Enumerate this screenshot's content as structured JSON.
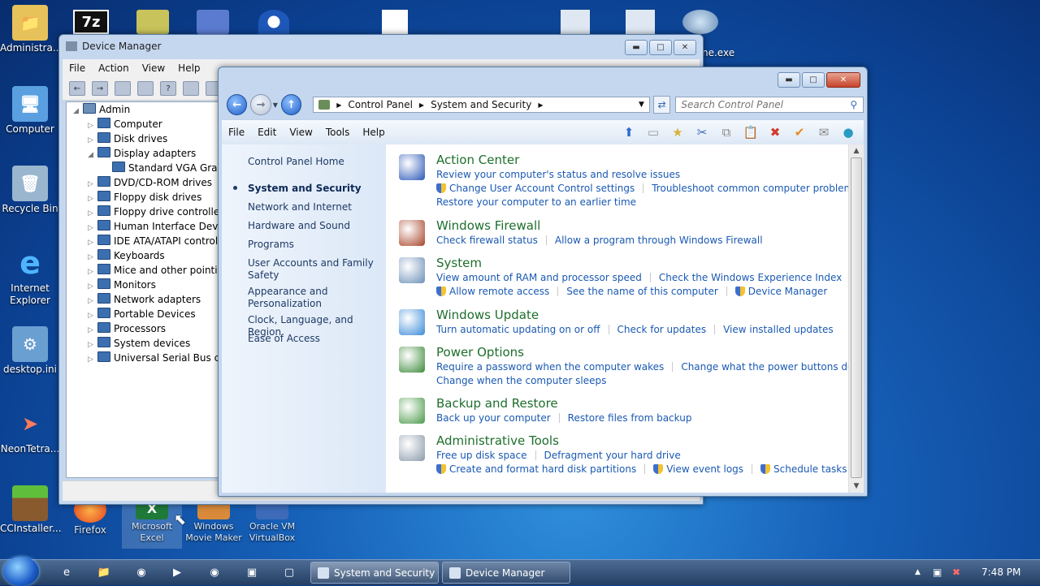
{
  "desktop": {
    "icons": [
      {
        "label": "Administra..."
      },
      {
        "label": "Computer"
      },
      {
        "label": "Recycle Bin"
      },
      {
        "label": "Internet Explorer"
      },
      {
        "label": "desktop.ini"
      },
      {
        "label": "NeonTetra..."
      },
      {
        "label": "CCInstaller..."
      },
      {
        "label": "Firefox"
      },
      {
        "label": "Microsoft Excel"
      },
      {
        "label": "Windows Movie Maker"
      },
      {
        "label": "Oracle VM VirtualBox"
      },
      {
        "label": "ne.exe"
      }
    ],
    "top_icon_glyph": "7z"
  },
  "device_manager": {
    "title": "Device Manager",
    "menu": [
      "File",
      "Action",
      "View",
      "Help"
    ],
    "tree": {
      "root": "Admin",
      "items": [
        {
          "label": "Computer",
          "expanded": false
        },
        {
          "label": "Disk drives",
          "expanded": false
        },
        {
          "label": "Display adapters",
          "expanded": true
        },
        {
          "label": "Standard VGA Graphics Adapter",
          "child": true
        },
        {
          "label": "DVD/CD-ROM drives",
          "expanded": false
        },
        {
          "label": "Floppy disk drives",
          "expanded": false
        },
        {
          "label": "Floppy drive controllers",
          "expanded": false
        },
        {
          "label": "Human Interface Devices",
          "expanded": false
        },
        {
          "label": "IDE ATA/ATAPI controllers",
          "expanded": false
        },
        {
          "label": "Keyboards",
          "expanded": false
        },
        {
          "label": "Mice and other pointing devices",
          "expanded": false
        },
        {
          "label": "Monitors",
          "expanded": false
        },
        {
          "label": "Network adapters",
          "expanded": false
        },
        {
          "label": "Portable Devices",
          "expanded": false
        },
        {
          "label": "Processors",
          "expanded": false
        },
        {
          "label": "System devices",
          "expanded": false
        },
        {
          "label": "Universal Serial Bus controllers",
          "expanded": false
        }
      ]
    }
  },
  "control_panel": {
    "breadcrumb": [
      "Control Panel",
      "System and Security"
    ],
    "search_placeholder": "Search Control Panel",
    "menu": [
      "File",
      "Edit",
      "View",
      "Tools",
      "Help"
    ],
    "left_nav": [
      {
        "label": "Control Panel Home",
        "current": false
      },
      {
        "label": "System and Security",
        "current": true
      },
      {
        "label": "Network and Internet",
        "current": false
      },
      {
        "label": "Hardware and Sound",
        "current": false
      },
      {
        "label": "Programs",
        "current": false
      },
      {
        "label": "User Accounts and Family Safety",
        "current": false
      },
      {
        "label": "Appearance and Personalization",
        "current": false
      },
      {
        "label": "Clock, Language, and Region",
        "current": false
      },
      {
        "label": "Ease of Access",
        "current": false
      }
    ],
    "categories": [
      {
        "title": "Action Center",
        "lines": [
          [
            {
              "text": "Review your computer's status and resolve issues"
            }
          ],
          [
            {
              "text": "Change User Account Control settings",
              "shield": true
            },
            {
              "text": "Troubleshoot common computer problems"
            }
          ],
          [
            {
              "text": "Restore your computer to an earlier time"
            }
          ]
        ]
      },
      {
        "title": "Windows Firewall",
        "lines": [
          [
            {
              "text": "Check firewall status"
            },
            {
              "text": "Allow a program through Windows Firewall"
            }
          ]
        ]
      },
      {
        "title": "System",
        "lines": [
          [
            {
              "text": "View amount of RAM and processor speed"
            },
            {
              "text": "Check the Windows Experience Index"
            }
          ],
          [
            {
              "text": "Allow remote access",
              "shield": true
            },
            {
              "text": "See the name of this computer"
            },
            {
              "text": "Device Manager",
              "shield": true
            }
          ]
        ]
      },
      {
        "title": "Windows Update",
        "lines": [
          [
            {
              "text": "Turn automatic updating on or off"
            },
            {
              "text": "Check for updates"
            },
            {
              "text": "View installed updates"
            }
          ]
        ]
      },
      {
        "title": "Power Options",
        "lines": [
          [
            {
              "text": "Require a password when the computer wakes"
            },
            {
              "text": "Change what the power buttons do"
            }
          ],
          [
            {
              "text": "Change when the computer sleeps"
            }
          ]
        ]
      },
      {
        "title": "Backup and Restore",
        "lines": [
          [
            {
              "text": "Back up your computer"
            },
            {
              "text": "Restore files from backup"
            }
          ]
        ]
      },
      {
        "title": "Administrative Tools",
        "lines": [
          [
            {
              "text": "Free up disk space"
            },
            {
              "text": "Defragment your hard drive"
            }
          ],
          [
            {
              "text": "Create and format hard disk partitions",
              "shield": true
            },
            {
              "text": "View event logs",
              "shield": true
            },
            {
              "text": "Schedule tasks",
              "shield": true
            }
          ]
        ]
      }
    ]
  },
  "taskbar": {
    "buttons": [
      {
        "label": "System and Security"
      },
      {
        "label": "Device Manager"
      }
    ],
    "clock": "7:48 PM"
  },
  "colors": {
    "link": "#1a59b3",
    "category_title": "#1e6e2c",
    "nav_text": "#1e3a64"
  }
}
